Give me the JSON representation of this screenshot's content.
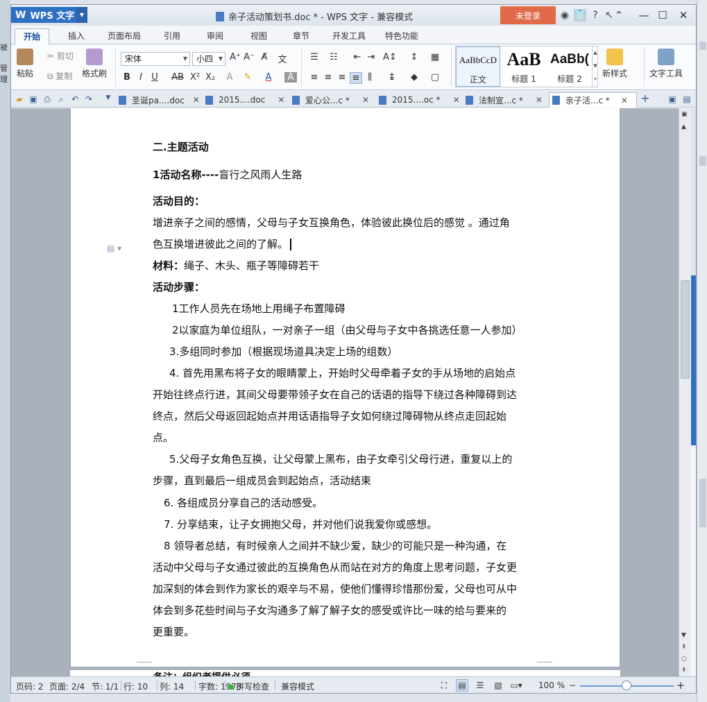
{
  "app": {
    "name": "WPS 文字",
    "window_title": "亲子活动策划书.doc * - WPS 文字 - 兼容模式",
    "login_label": "未登录"
  },
  "desktop_left_labels": [
    "被",
    "管理"
  ],
  "ribbon_tabs": [
    "开始",
    "插入",
    "页面布局",
    "引用",
    "审阅",
    "视图",
    "章节",
    "开发工具",
    "特色功能"
  ],
  "active_tab": "开始",
  "ribbon": {
    "paste": "粘贴",
    "cut": "剪切",
    "copy": "复制",
    "format_painter": "格式刷",
    "font_name": "宋体",
    "font_size": "小四",
    "styles": [
      {
        "preview": "AaBbCcD",
        "name": "正文"
      },
      {
        "preview": "AaB",
        "name": "标题 1"
      },
      {
        "preview": "AaBb(",
        "name": "标题 2"
      }
    ],
    "new_style": "新样式",
    "text_tools": "文字工具"
  },
  "doc_tabs": [
    {
      "label": "圣诞pa....doc",
      "active": false
    },
    {
      "label": "2015....doc",
      "active": false
    },
    {
      "label": "爱心公...c *",
      "active": false
    },
    {
      "label": "2015....oc *",
      "active": false
    },
    {
      "label": "法制宣...c *",
      "active": false
    },
    {
      "label": "亲子活...c *",
      "active": true
    }
  ],
  "document": {
    "lines": [
      {
        "text": "二.主题活动",
        "bold": true
      },
      {
        "bold_prefix": "1活动名称----",
        "text": "盲行之风雨人生路"
      },
      {
        "text": "活动目的：",
        "bold": true
      },
      {
        "text": "增进亲子之间的感情，父母与子女互换角色，体验彼此换位后的感觉 。通过角"
      },
      {
        "text": "色互换增进彼此之间的了解。",
        "caret": true
      },
      {
        "bold_prefix": "材料：",
        "text": "绳子、木头、瓶子等障碍若干"
      },
      {
        "text": "活动步骤：",
        "bold": true
      },
      {
        "text": "1工作人员先在场地上用绳子布置障碍"
      },
      {
        "text": "2以家庭为单位组队，一对亲子一组（由父母与子女中各挑选任意一人参加）"
      },
      {
        "text": "3.多组同时参加（根据现场道具决定上场的组数）"
      },
      {
        "text": "4. 首先用黑布将子女的眼睛蒙上，开始时父母牵着子女的手从场地的启始点"
      },
      {
        "text": "开始往终点行进，其间父母要带领子女在自己的话语的指导下绕过各种障碍到达"
      },
      {
        "text": "终点，然后父母返回起始点并用话语指导子女如何绕过障碍物从终点走回起始"
      },
      {
        "text": "点。"
      },
      {
        "text": "5.父母子女角色互换，让父母蒙上黑布，由子女牵引父母行进，重复以上的"
      },
      {
        "text": "步骤，直到最后一组成员会到起始点，活动结束"
      },
      {
        "text": "6. 各组成员分享自己的活动感受。"
      },
      {
        "text": "7. 分享结束，让子女拥抱父母，并对他们说我爱你或感想。"
      },
      {
        "text": "8   领导者总结，有时候亲人之间并不缺少爱，缺少的可能只是一种沟通，在"
      },
      {
        "text": "活动中父母与子女通过彼此的互换角色从而站在对方的角度上思考问题，子女更"
      },
      {
        "text": "加深刻的体会到作为家长的艰辛与不易，使他们懂得珍惜那份爱，父母也可从中"
      },
      {
        "text": "体会到多花些时间与子女沟通多了解了解子女的感受或许比一味的给与要来的"
      },
      {
        "text": "更重要。"
      }
    ],
    "next_page_fragment": "备注：组织者提供必须"
  },
  "status": {
    "page_code": "页码: 2",
    "page": "页面: 2/4",
    "section": "节: 1/1",
    "row": "行: 10",
    "col": "列: 14",
    "word_count": "字数: 1973",
    "spell_check": "拼写检查",
    "compat_mode": "兼容模式",
    "zoom": "100 %"
  },
  "zoom_level": 1.0
}
